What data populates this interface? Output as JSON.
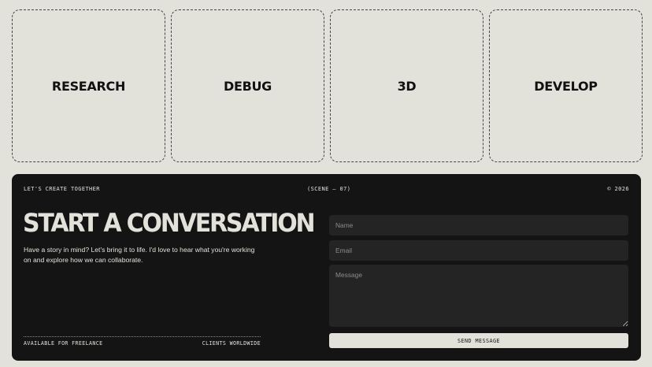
{
  "services": [
    {
      "label": "RESEARCH"
    },
    {
      "label": "DEBUG"
    },
    {
      "label": "3D"
    },
    {
      "label": "DEVELOP"
    }
  ],
  "contact": {
    "eyebrow": "LET'S CREATE TOGETHER",
    "scene": "(SCENE — 07)",
    "copyright": "© 2026",
    "title": "START A CONVERSATION",
    "intro": "Have a story in mind? Let's bring it to life. I'd love to hear what you're working on and explore how we can collaborate.",
    "availability": "AVAILABLE FOR FREELANCE",
    "clients": "CLIENTS WORLDWIDE",
    "form": {
      "name_placeholder": "Name",
      "name_value": "",
      "email_placeholder": "Email",
      "email_value": "",
      "message_placeholder": "Message",
      "message_value": "",
      "submit_label": "SEND MESSAGE"
    }
  }
}
